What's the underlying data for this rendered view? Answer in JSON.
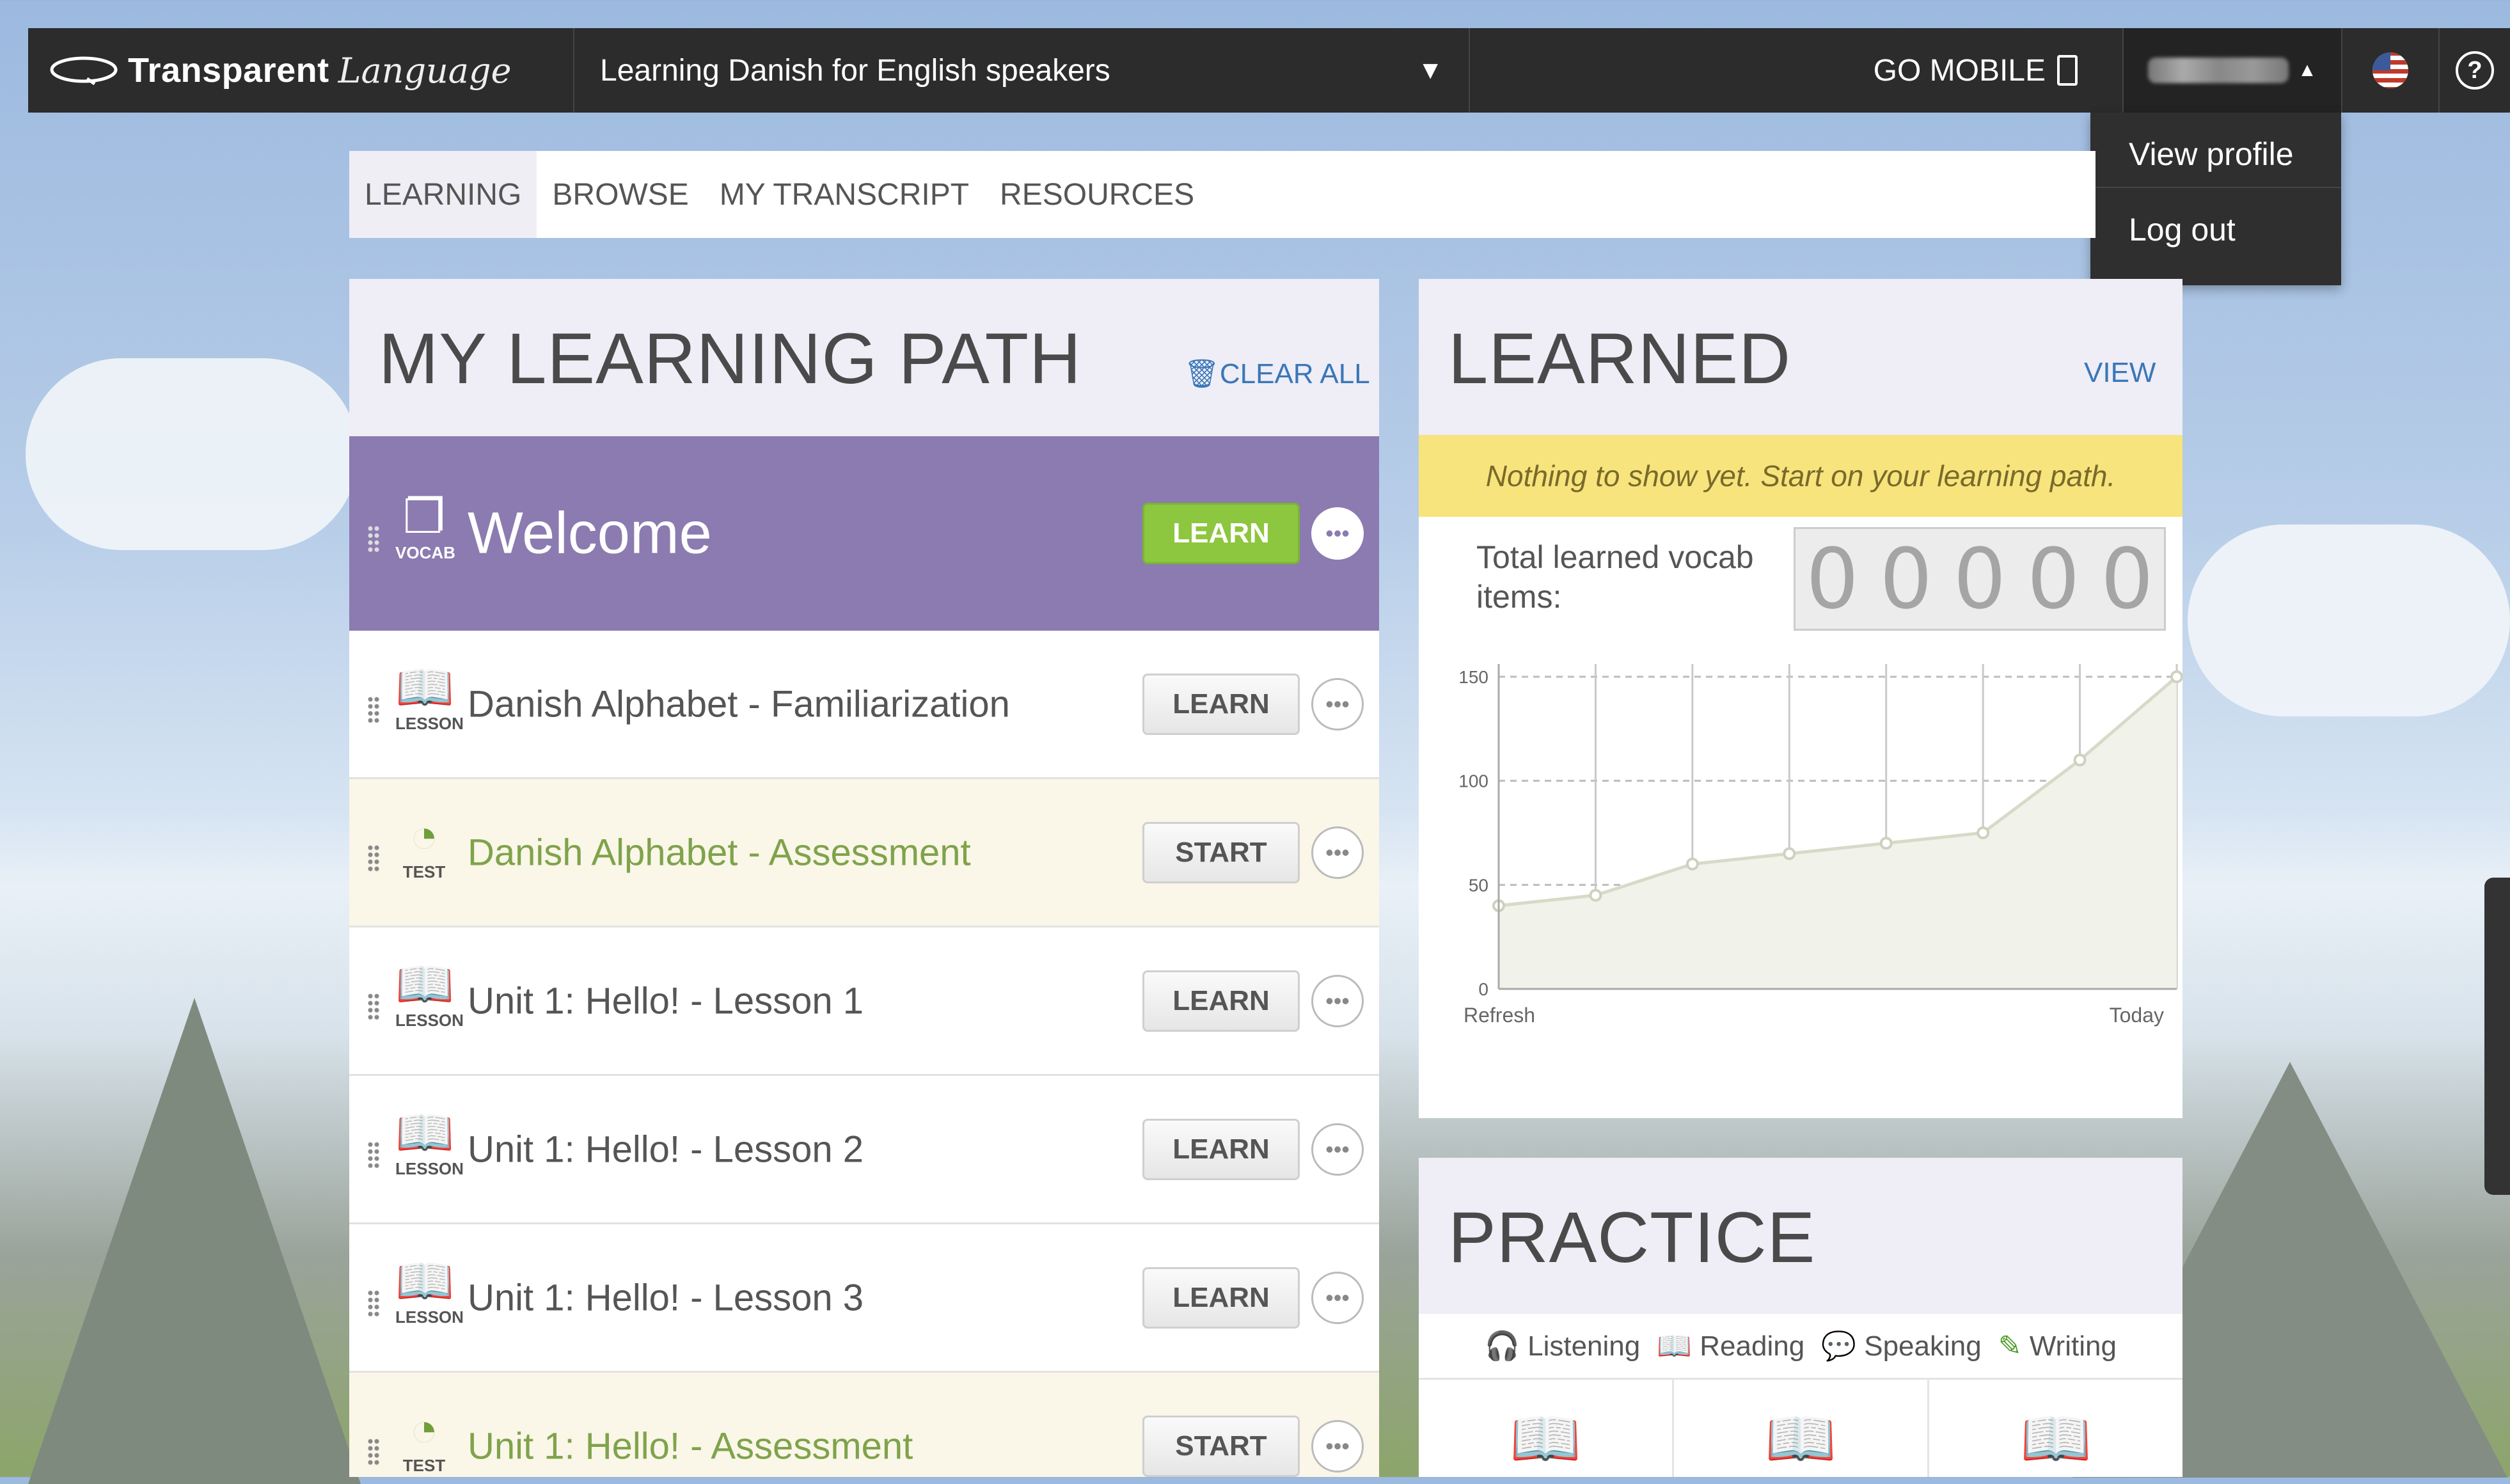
{
  "topbar": {
    "logo_text": "Transparent",
    "logo_text2": "Language",
    "course_title": "Learning Danish for English speakers",
    "go_mobile": "GO MOBILE"
  },
  "user_menu": {
    "items": [
      "View profile",
      "Log out"
    ]
  },
  "nav": {
    "tabs": [
      "LEARNING",
      "BROWSE",
      "MY TRANSCRIPT",
      "RESOURCES"
    ],
    "active": "LEARNING"
  },
  "path": {
    "title": "MY LEARNING PATH",
    "clear_all": "CLEAR ALL",
    "items": [
      {
        "kind": "VOCAB",
        "title": "Welcome",
        "action": "LEARN",
        "state": "current"
      },
      {
        "kind": "LESSON",
        "title": "Danish Alphabet - Familiarization",
        "action": "LEARN",
        "state": "normal"
      },
      {
        "kind": "TEST",
        "title": "Danish Alphabet - Assessment",
        "action": "START",
        "state": "test"
      },
      {
        "kind": "LESSON",
        "title": "Unit 1: Hello! - Lesson 1",
        "action": "LEARN",
        "state": "normal"
      },
      {
        "kind": "LESSON",
        "title": "Unit 1: Hello! - Lesson 2",
        "action": "LEARN",
        "state": "normal"
      },
      {
        "kind": "LESSON",
        "title": "Unit 1: Hello! - Lesson 3",
        "action": "LEARN",
        "state": "normal"
      },
      {
        "kind": "TEST",
        "title": "Unit 1: Hello! - Assessment",
        "action": "START",
        "state": "test"
      }
    ]
  },
  "learned": {
    "title": "LEARNED",
    "view": "VIEW",
    "notice": "Nothing to show yet. Start on your learning path.",
    "vocab_label": "Total learned vocab items:",
    "counter": [
      "0",
      "0",
      "0",
      "0",
      "0"
    ]
  },
  "chart_data": {
    "type": "area",
    "x": [
      0,
      1,
      2,
      3,
      4,
      5,
      6,
      7
    ],
    "values": [
      40,
      45,
      60,
      65,
      70,
      75,
      110,
      150
    ],
    "yticks": [
      0,
      50,
      100,
      150
    ],
    "ylim": [
      0,
      150
    ],
    "xlabel_left": "Refresh",
    "xlabel_right": "Today"
  },
  "practice": {
    "title": "PRACTICE",
    "skills": [
      "Listening",
      "Reading",
      "Speaking",
      "Writing"
    ]
  },
  "colors": {
    "accent": "#8b7bb0",
    "link": "#3a77b8",
    "learn_green": "#8dc63f",
    "notice_yellow": "#f7e47d"
  }
}
